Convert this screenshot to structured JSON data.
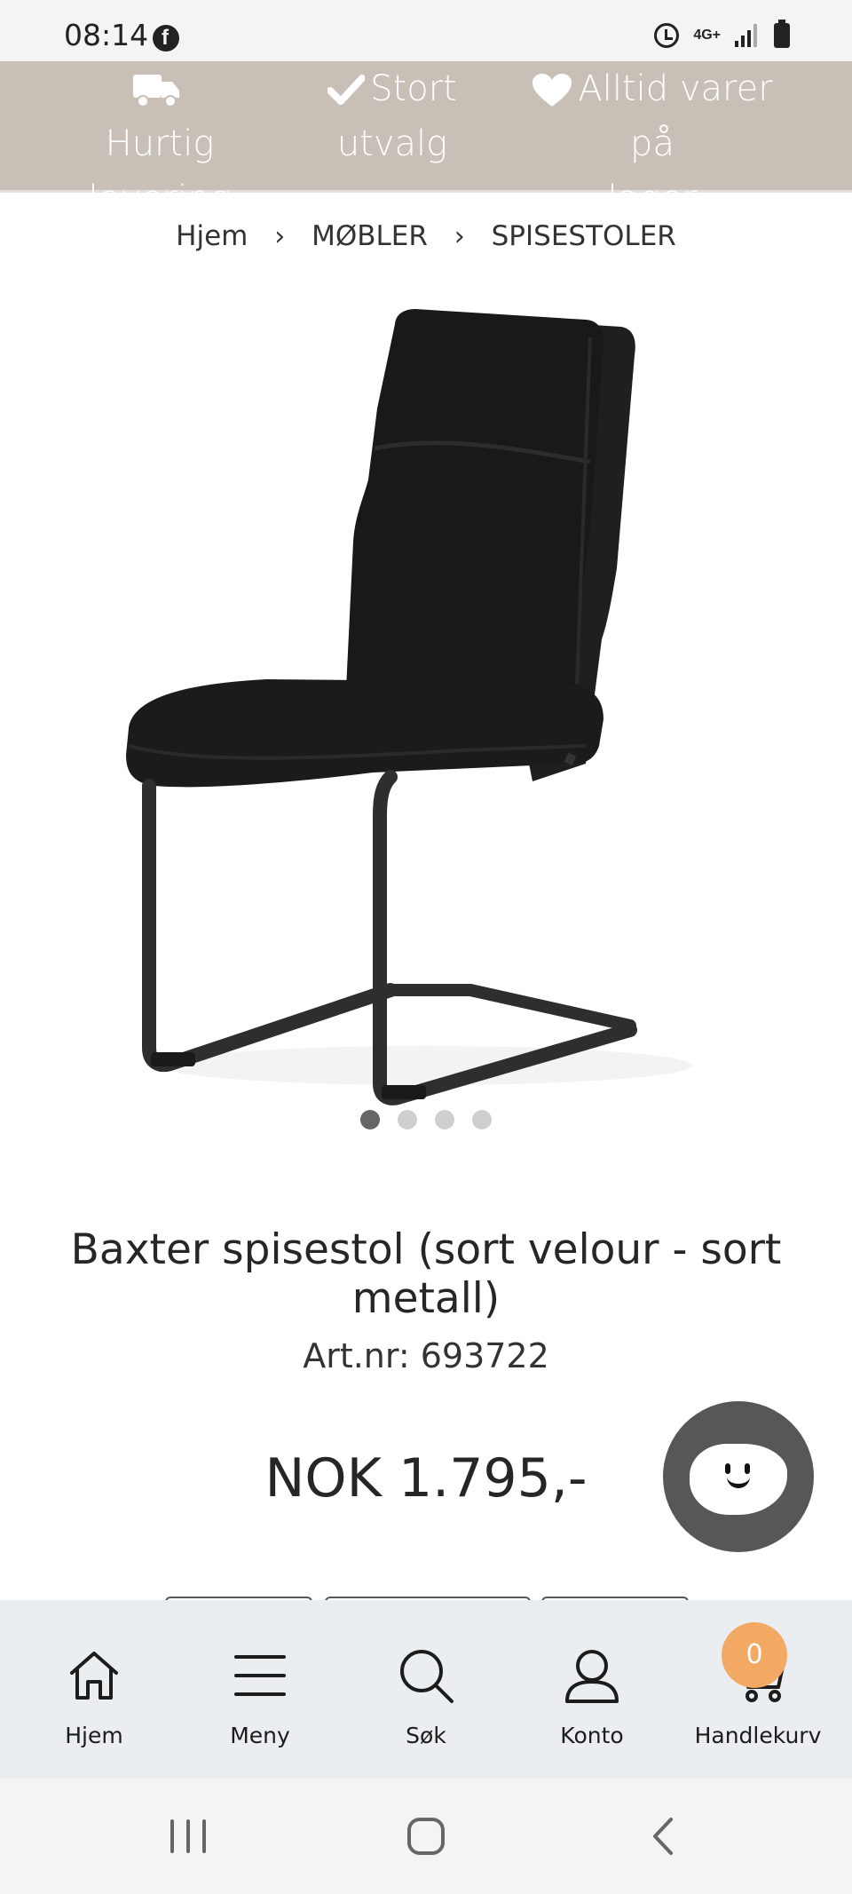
{
  "status_bar": {
    "time": "08:14",
    "network": "4G+"
  },
  "promo": {
    "items": [
      {
        "icon": "truck-icon",
        "line1": "Hurtig",
        "line2": "levering"
      },
      {
        "icon": "check-icon",
        "line1": "Stort",
        "line2": "utvalg"
      },
      {
        "icon": "heart-icon",
        "line1": "Alltid varer på",
        "line2": "lager"
      }
    ]
  },
  "breadcrumb": {
    "items": [
      "Hjem",
      "MØBLER",
      "SPISESTOLER"
    ]
  },
  "gallery": {
    "total_images": 4,
    "active_index": 0
  },
  "product": {
    "title": "Baxter spisestol (sort velour - sort metall)",
    "artnr": "Art.nr: 693722",
    "price": "NOK 1.795,-"
  },
  "bottom_nav": {
    "items": [
      {
        "icon": "home-icon",
        "label": "Hjem"
      },
      {
        "icon": "menu-icon",
        "label": "Meny"
      },
      {
        "icon": "search-icon",
        "label": "Søk"
      },
      {
        "icon": "user-icon",
        "label": "Konto"
      },
      {
        "icon": "cart-icon",
        "label": "Handlekurv"
      }
    ],
    "cart_count": "0"
  },
  "colors": {
    "promo_bg": "#c8bfb6",
    "cart_badge": "#f2a964",
    "chat_bubble": "#575757",
    "nav_bg": "#ebeef1"
  }
}
